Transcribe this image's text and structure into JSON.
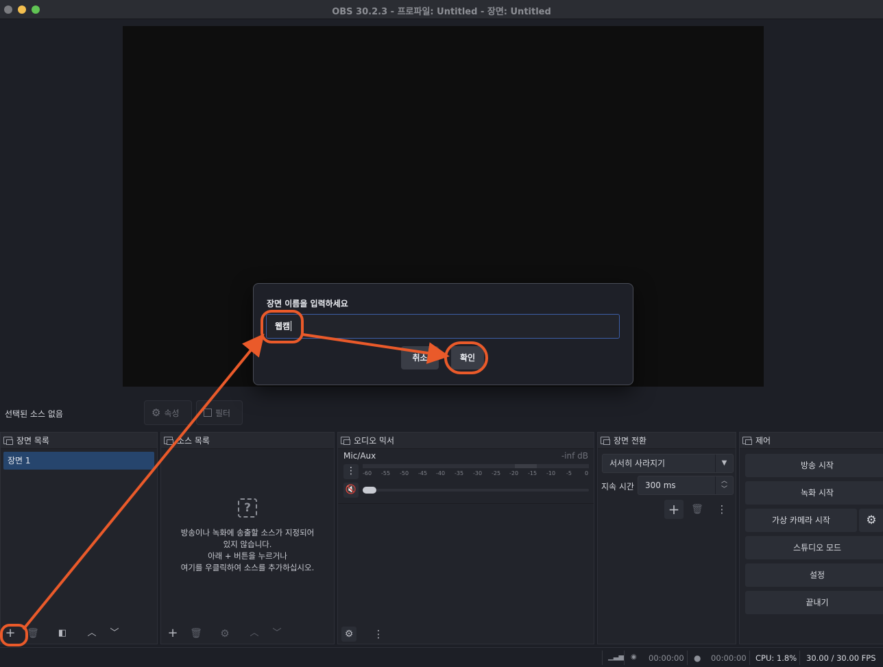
{
  "window": {
    "title": "OBS 30.2.3 - 프로파일: Untitled - 장면: Untitled"
  },
  "source_bar": {
    "no_source": "선택된 소스 없음",
    "properties_label": "속성",
    "filters_label": "필터"
  },
  "scenes": {
    "title": "장면 목록",
    "items": [
      {
        "label": "장면 1"
      }
    ]
  },
  "sources": {
    "title": "소스 목록",
    "empty_line1": "방송이나 녹화에 송출할 소스가 지정되어",
    "empty_line2": "있지 않습니다.",
    "empty_line3": "아래 + 버튼을 누르거나",
    "empty_line4": "여기를 우클릭하여 소스를 추가하십시오."
  },
  "mixer": {
    "title": "오디오 믹서",
    "channel": "Mic/Aux",
    "level": "-inf dB",
    "scale": [
      "-60",
      "-55",
      "-50",
      "-45",
      "-40",
      "-35",
      "-30",
      "-25",
      "-20",
      "-15",
      "-10",
      "-5",
      "0"
    ]
  },
  "transitions": {
    "title": "장면 전환",
    "selected": "서서히 사라지기",
    "duration_label": "지속 시간",
    "duration_value": "300 ms"
  },
  "controls": {
    "title": "제어",
    "start_stream": "방송 시작",
    "start_record": "녹화 시작",
    "start_virtual_cam": "가상 카메라 시작",
    "studio_mode": "스튜디오 모드",
    "settings": "설정",
    "exit": "끝내기"
  },
  "status": {
    "stream_time": "00:00:00",
    "record_time": "00:00:00",
    "cpu": "CPU: 1.8%",
    "fps": "30.00 / 30.00 FPS"
  },
  "dialog": {
    "prompt": "장면 이름을 입력하세요",
    "value": "웹캠",
    "cancel_label": "취소",
    "ok_label": "확인"
  },
  "colors": {
    "accent": "#ea5a2a",
    "selection": "#26456d"
  }
}
